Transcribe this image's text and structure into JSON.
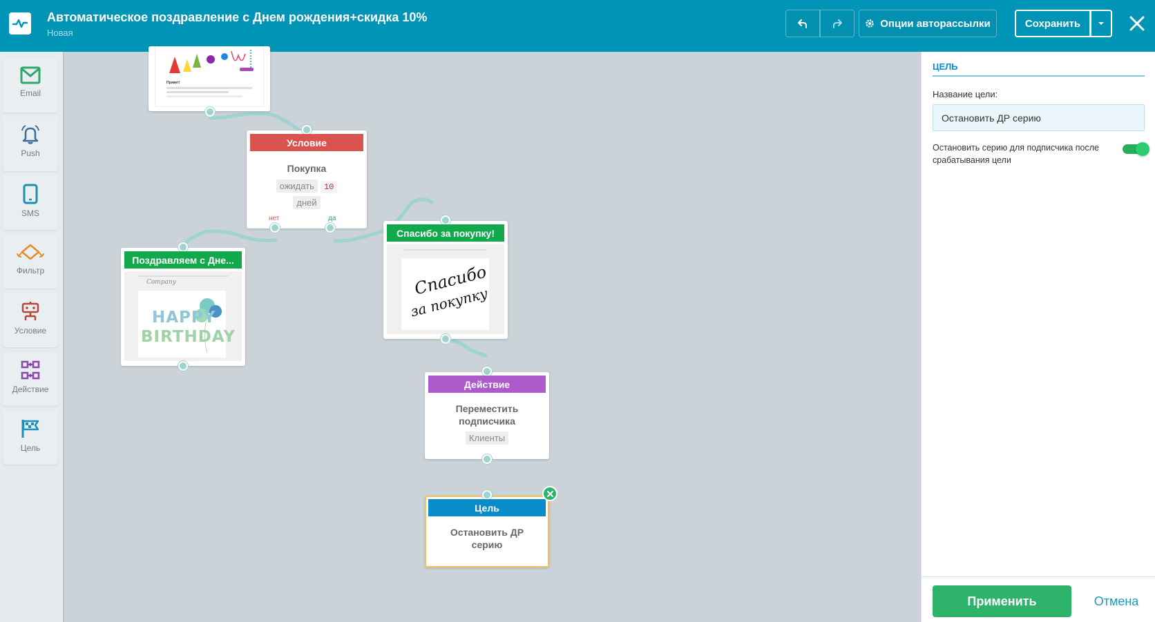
{
  "header": {
    "title": "Автоматическое поздравление с Днем рождения+скидка 10%",
    "status": "Новая",
    "options_label": "Опции авторассылки",
    "save_label": "Сохранить",
    "undo_icon": "undo-icon",
    "redo_icon": "redo-icon",
    "close_icon": "close-icon"
  },
  "toolbar": {
    "items": [
      {
        "label": "Email",
        "icon": "email-icon"
      },
      {
        "label": "Push",
        "icon": "bell-icon"
      },
      {
        "label": "SMS",
        "icon": "phone-icon"
      },
      {
        "label": "Фильтр",
        "icon": "filter-icon"
      },
      {
        "label": "Условие",
        "icon": "condition-icon"
      },
      {
        "label": "Действие",
        "icon": "action-icon"
      },
      {
        "label": "Цель",
        "icon": "flag-icon"
      }
    ]
  },
  "canvas": {
    "condition": {
      "title": "Условие",
      "name": "Покупка",
      "wait_label": "ожидать",
      "wait_value": "10",
      "wait_unit": "дней",
      "no_label": "нет",
      "yes_label": "да"
    },
    "email_birthday": {
      "title": "Поздравляем с Дне...",
      "preview_brand": "Company",
      "preview_line1": "HAPPY",
      "preview_line2": "BIRTHDAY"
    },
    "email_thanks": {
      "title": "Спасибо за покупку!",
      "preview_line1": "Спасибо",
      "preview_line2": "за покупку"
    },
    "email_top": {
      "preview_greeting": "Привет!"
    },
    "action": {
      "title": "Действие",
      "text": "Переместить подписчика",
      "tag": "Клиенты"
    },
    "goal": {
      "title": "Цель",
      "text": "Остановить ДР серию"
    }
  },
  "panel": {
    "title": "ЦЕЛЬ",
    "name_label": "Название цели:",
    "name_value": "Остановить ДР серию",
    "toggle_label": "Остановить серию для подписчика после срабатывания цели",
    "toggle_on": true,
    "apply_label": "Применить",
    "cancel_label": "Отмена"
  },
  "colors": {
    "header": "#0095b6",
    "condition": "#d9534f",
    "email": "#11a94b",
    "action": "#ad5acb",
    "goal": "#0a8ccb",
    "connector": "#9ed3d0",
    "apply": "#2db36a"
  }
}
